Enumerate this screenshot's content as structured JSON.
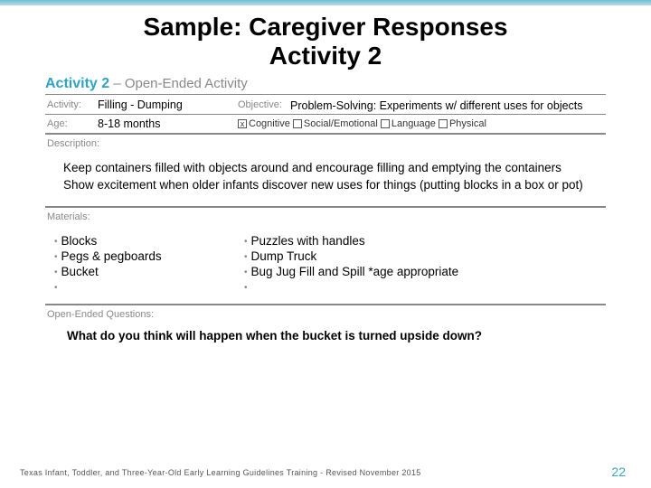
{
  "title_line1": "Sample: Caregiver Responses",
  "title_line2": "Activity 2",
  "activity_bar": {
    "prefix": "Activity ",
    "num": "2",
    "sub": " – Open-Ended Activity"
  },
  "labels": {
    "activity": "Activity:",
    "objective": "Objective:",
    "age": "Age:",
    "description": "Description:",
    "materials": "Materials:",
    "questions": "Open-Ended Questions:"
  },
  "activity_name": "Filling - Dumping",
  "objective": "Problem-Solving: Experiments w/ different uses for objects",
  "age": "8-18 months",
  "domains": {
    "cognitive": "Cognitive",
    "social": "Social/Emotional",
    "language": "Language",
    "physical": "Physical",
    "checked_mark": "x"
  },
  "description": {
    "p1": "Keep containers filled with objects around and encourage filling and emptying the containers",
    "p2": "Show excitement when older infants discover new uses for things (putting blocks in a box or pot)"
  },
  "materials_left": [
    "Blocks",
    "Pegs & pegboards",
    "Bucket",
    ""
  ],
  "materials_right": [
    "Puzzles with handles",
    "Dump Truck",
    "Bug Jug Fill and Spill *age appropriate",
    ""
  ],
  "question": "What do you think will happen when the bucket is turned upside down?",
  "footer": "Texas Infant, Toddler, and Three-Year-Old Early Learning Guidelines Training -  Revised November 2015",
  "pagenum": "22"
}
